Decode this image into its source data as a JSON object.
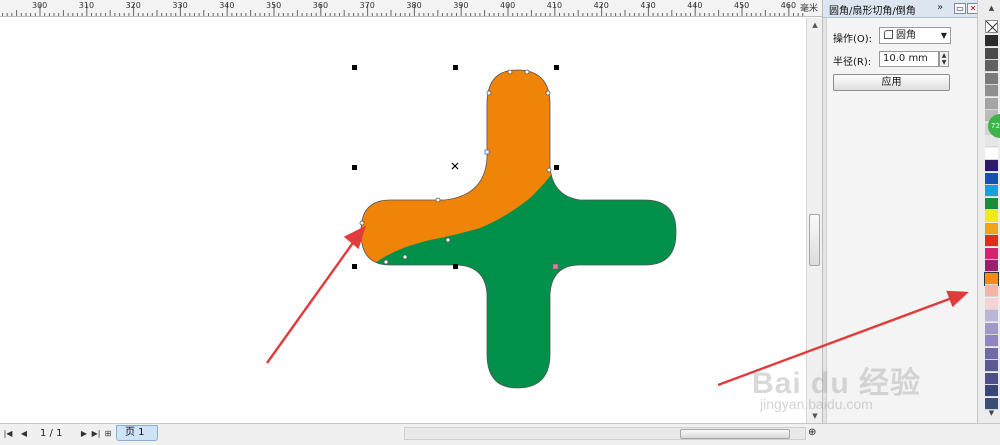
{
  "ruler": {
    "labels": [
      "300",
      "310",
      "320",
      "330",
      "340",
      "350",
      "360",
      "370",
      "380",
      "390",
      "400",
      "410",
      "420",
      "430",
      "440",
      "450",
      "460"
    ],
    "end_symbol": "毫米"
  },
  "docker": {
    "title": "圆角/扇形切角/倒角",
    "more_symbol": "»",
    "operation_label": "操作(O):",
    "operation_value": "圆角",
    "radius_label": "半径(R):",
    "radius_value": "10.0 mm",
    "apply_label": "应用"
  },
  "pager": {
    "page_count": "1 / 1",
    "page_tab": "页 1"
  },
  "palette": {
    "colors": [
      "#2b2b2b",
      "#4a4a4a",
      "#616161",
      "#7a7a7a",
      "#8f8f8f",
      "#a5a5a5",
      "#bbbbbb",
      "#d2d2d2",
      "#e6e6e6",
      "#ffffff",
      "#2c1a66",
      "#1a4fb0",
      "#1aa0d8",
      "#1a8c3c",
      "#f2e81a",
      "#f0a21a",
      "#e22a1f",
      "#d5246f",
      "#9b1f6e",
      "#f28a1c",
      "#f2b5a5",
      "#f4d3d2",
      "#bab6d8",
      "#9f98c8",
      "#8f86bf",
      "#6f6aa6",
      "#5c5a92",
      "#4d4f86",
      "#3c4577",
      "#3a4f78"
    ]
  },
  "drawing": {
    "orange": "#f08408",
    "green": "#00904a"
  },
  "watermark": {
    "main": "Bai du 经验",
    "sub": "jingyan.baidu.com"
  }
}
